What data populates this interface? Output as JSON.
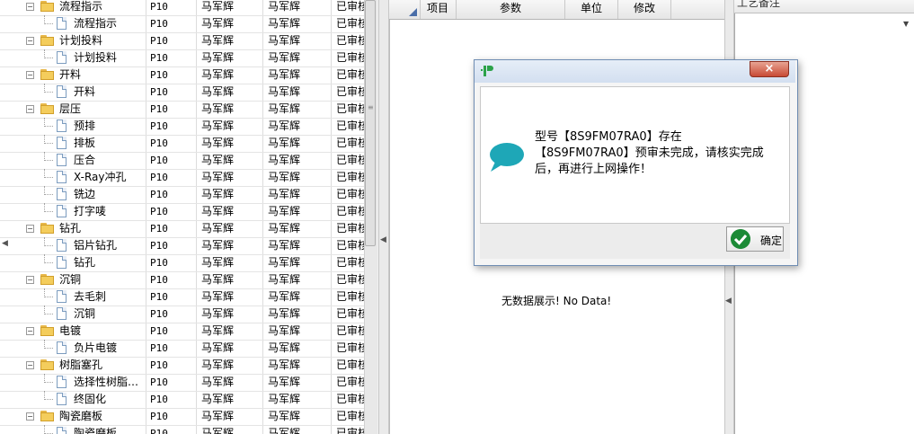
{
  "tree_rows": [
    {
      "level": 0,
      "label": "流程指示",
      "p": "P10",
      "a": "马军辉",
      "b": "马军辉",
      "status": "已审核"
    },
    {
      "level": 1,
      "label": "流程指示",
      "p": "P10",
      "a": "马军辉",
      "b": "马军辉",
      "status": "已审核"
    },
    {
      "level": 0,
      "label": "计划投料",
      "p": "P10",
      "a": "马军辉",
      "b": "马军辉",
      "status": "已审核"
    },
    {
      "level": 1,
      "label": "计划投料",
      "p": "P10",
      "a": "马军辉",
      "b": "马军辉",
      "status": "已审核"
    },
    {
      "level": 0,
      "label": "开料",
      "p": "P10",
      "a": "马军辉",
      "b": "马军辉",
      "status": "已审核"
    },
    {
      "level": 1,
      "label": "开料",
      "p": "P10",
      "a": "马军辉",
      "b": "马军辉",
      "status": "已审核"
    },
    {
      "level": 0,
      "label": "层压",
      "p": "P10",
      "a": "马军辉",
      "b": "马军辉",
      "status": "已审核"
    },
    {
      "level": 1,
      "label": "预排",
      "p": "P10",
      "a": "马军辉",
      "b": "马军辉",
      "status": "已审核"
    },
    {
      "level": 1,
      "label": "排板",
      "p": "P10",
      "a": "马军辉",
      "b": "马军辉",
      "status": "已审核"
    },
    {
      "level": 1,
      "label": "压合",
      "p": "P10",
      "a": "马军辉",
      "b": "马军辉",
      "status": "已审核"
    },
    {
      "level": 1,
      "label": "X-Ray冲孔",
      "p": "P10",
      "a": "马军辉",
      "b": "马军辉",
      "status": "已审核"
    },
    {
      "level": 1,
      "label": "铣边",
      "p": "P10",
      "a": "马军辉",
      "b": "马军辉",
      "status": "已审核"
    },
    {
      "level": 1,
      "label": "打字唛",
      "p": "P10",
      "a": "马军辉",
      "b": "马军辉",
      "status": "已审核"
    },
    {
      "level": 0,
      "label": "钻孔",
      "p": "P10",
      "a": "马军辉",
      "b": "马军辉",
      "status": "已审核"
    },
    {
      "level": 1,
      "label": "铝片钻孔",
      "p": "P10",
      "a": "马军辉",
      "b": "马军辉",
      "status": "已审核"
    },
    {
      "level": 1,
      "label": "钻孔",
      "p": "P10",
      "a": "马军辉",
      "b": "马军辉",
      "status": "已审核"
    },
    {
      "level": 0,
      "label": "沉铜",
      "p": "P10",
      "a": "马军辉",
      "b": "马军辉",
      "status": "已审核"
    },
    {
      "level": 1,
      "label": "去毛刺",
      "p": "P10",
      "a": "马军辉",
      "b": "马军辉",
      "status": "已审核"
    },
    {
      "level": 1,
      "label": "沉铜",
      "p": "P10",
      "a": "马军辉",
      "b": "马军辉",
      "status": "已审核"
    },
    {
      "level": 0,
      "label": "电镀",
      "p": "P10",
      "a": "马军辉",
      "b": "马军辉",
      "status": "已审核"
    },
    {
      "level": 1,
      "label": "负片电镀",
      "p": "P10",
      "a": "马军辉",
      "b": "马军辉",
      "status": "已审核"
    },
    {
      "level": 0,
      "label": "树脂塞孔",
      "p": "P10",
      "a": "马军辉",
      "b": "马军辉",
      "status": "已审核"
    },
    {
      "level": 1,
      "label": "选择性树脂…",
      "p": "P10",
      "a": "马军辉",
      "b": "马军辉",
      "status": "已审核"
    },
    {
      "level": 1,
      "label": "终固化",
      "p": "P10",
      "a": "马军辉",
      "b": "马军辉",
      "status": "已审核"
    },
    {
      "level": 0,
      "label": "陶瓷磨板",
      "p": "P10",
      "a": "马军辉",
      "b": "马军辉",
      "status": "已审核"
    },
    {
      "level": 1,
      "label": "陶瓷磨板",
      "p": "P10",
      "a": "马军辉",
      "b": "马军辉",
      "status": "已审核"
    }
  ],
  "middle_grid": {
    "columns": [
      "项目",
      "参数",
      "单位",
      "修改"
    ],
    "empty_text": "无数据展示! No Data!"
  },
  "right_panel": {
    "title": "工艺备注"
  },
  "dialog": {
    "close_label": "×",
    "message": "型号【8S9FM07RA0】存在【8S9FM07RA0】预审未完成，请核实完成后，再进行上网操作！",
    "ok_label": "确定"
  },
  "colors": {
    "bubble": "#1ea7b7",
    "ok_check": "#1c8a36",
    "close_button": "#c84a34"
  }
}
